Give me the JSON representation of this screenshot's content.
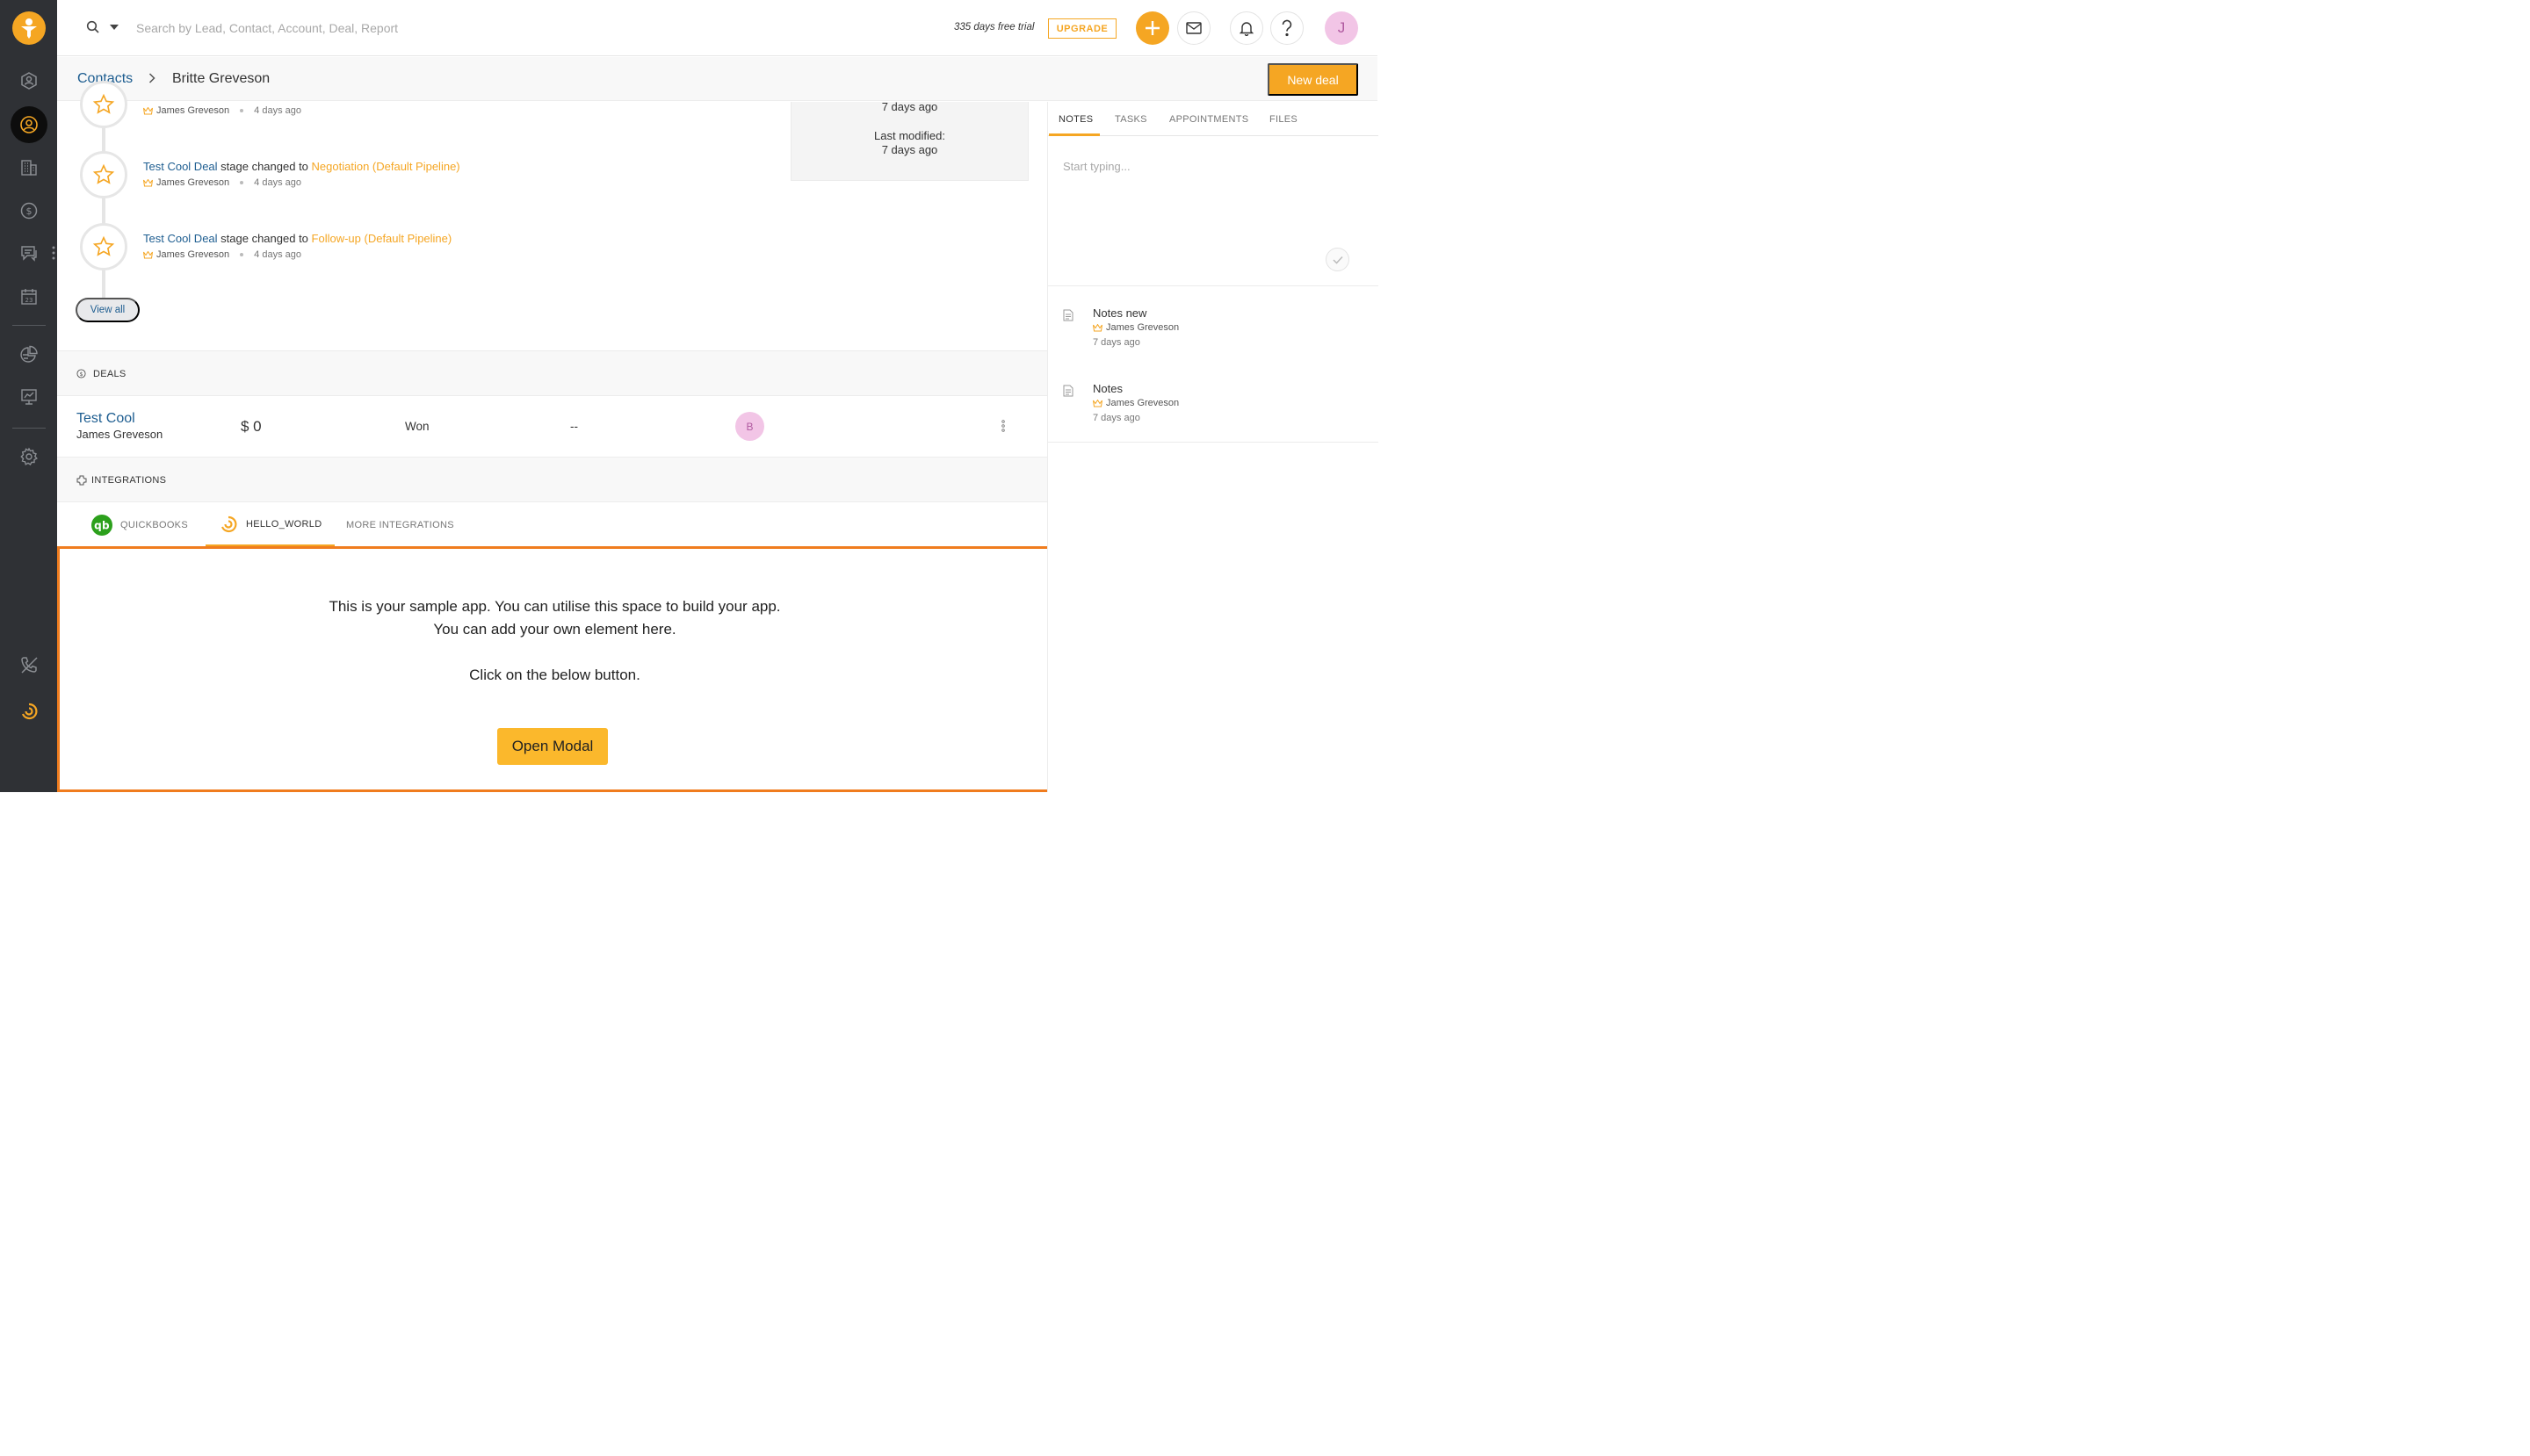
{
  "colors": {
    "accent": "#f5a623",
    "link": "#1d5d90",
    "sidebar": "#2f3135",
    "frame": "#f07c1e"
  },
  "topbar": {
    "search_placeholder": "Search by Lead, Contact, Account, Deal, Report",
    "trial_text": "335 days free trial",
    "upgrade_label": "UPGRADE",
    "avatar_initial": "J"
  },
  "sidebar": {
    "items": [
      {
        "icon": "dashboard-icon"
      },
      {
        "icon": "contacts-icon",
        "active": true
      },
      {
        "icon": "accounts-building-icon"
      },
      {
        "icon": "deals-dollar-icon"
      },
      {
        "icon": "conversations-icon"
      },
      {
        "icon": "calendar-icon",
        "label": "23"
      },
      {
        "icon": "reports-pie-icon"
      },
      {
        "icon": "analytics-icon"
      },
      {
        "icon": "settings-gear-icon"
      },
      {
        "icon": "phone-off-icon"
      },
      {
        "icon": "hello-world-app-icon"
      }
    ]
  },
  "header": {
    "breadcrumb_root": "Contacts",
    "breadcrumb_current": "Britte Greveson",
    "new_deal_label": "New deal"
  },
  "timeline": {
    "events": [
      {
        "deal": "",
        "text": "",
        "stage": "",
        "author": "James Greveson",
        "time": "4 days ago"
      },
      {
        "deal": "Test Cool Deal",
        "text": " stage changed to ",
        "stage": "Negotiation (Default Pipeline)",
        "author": "James Greveson",
        "time": "4 days ago"
      },
      {
        "deal": "Test Cool Deal",
        "text": " stage changed to ",
        "stage": "Follow-up (Default Pipeline)",
        "author": "James Greveson",
        "time": "4 days ago"
      }
    ],
    "view_all_label": "View all"
  },
  "info": {
    "created_value": "7 days ago",
    "modified_label": "Last modified:",
    "modified_value": "7 days ago"
  },
  "deals": {
    "section_label": "DEALS",
    "rows": [
      {
        "name": "Test Cool",
        "owner": "James Greveson",
        "amount": "$ 0",
        "stage": "Won",
        "close_date": "--",
        "avatar": "B"
      }
    ]
  },
  "integrations": {
    "section_label": "INTEGRATIONS",
    "tabs": [
      {
        "label": "QUICKBOOKS",
        "icon": "quickbooks-icon"
      },
      {
        "label": "HELLO_WORLD",
        "icon": "hello-world-icon",
        "active": true
      },
      {
        "label": "MORE INTEGRATIONS"
      }
    ],
    "app": {
      "line1": "This is your sample app. You can utilise this space to build your app.",
      "line2": "You can add your own element here.",
      "line3": "Click on the below button.",
      "button_label": "Open Modal"
    }
  },
  "right_panel": {
    "tabs": [
      "NOTES",
      "TASKS",
      "APPOINTMENTS",
      "FILES"
    ],
    "note_placeholder": "Start typing...",
    "notes": [
      {
        "title": "Notes new",
        "author": "James Greveson",
        "time": "7 days ago"
      },
      {
        "title": "Notes",
        "author": "James Greveson",
        "time": "7 days ago"
      }
    ]
  }
}
